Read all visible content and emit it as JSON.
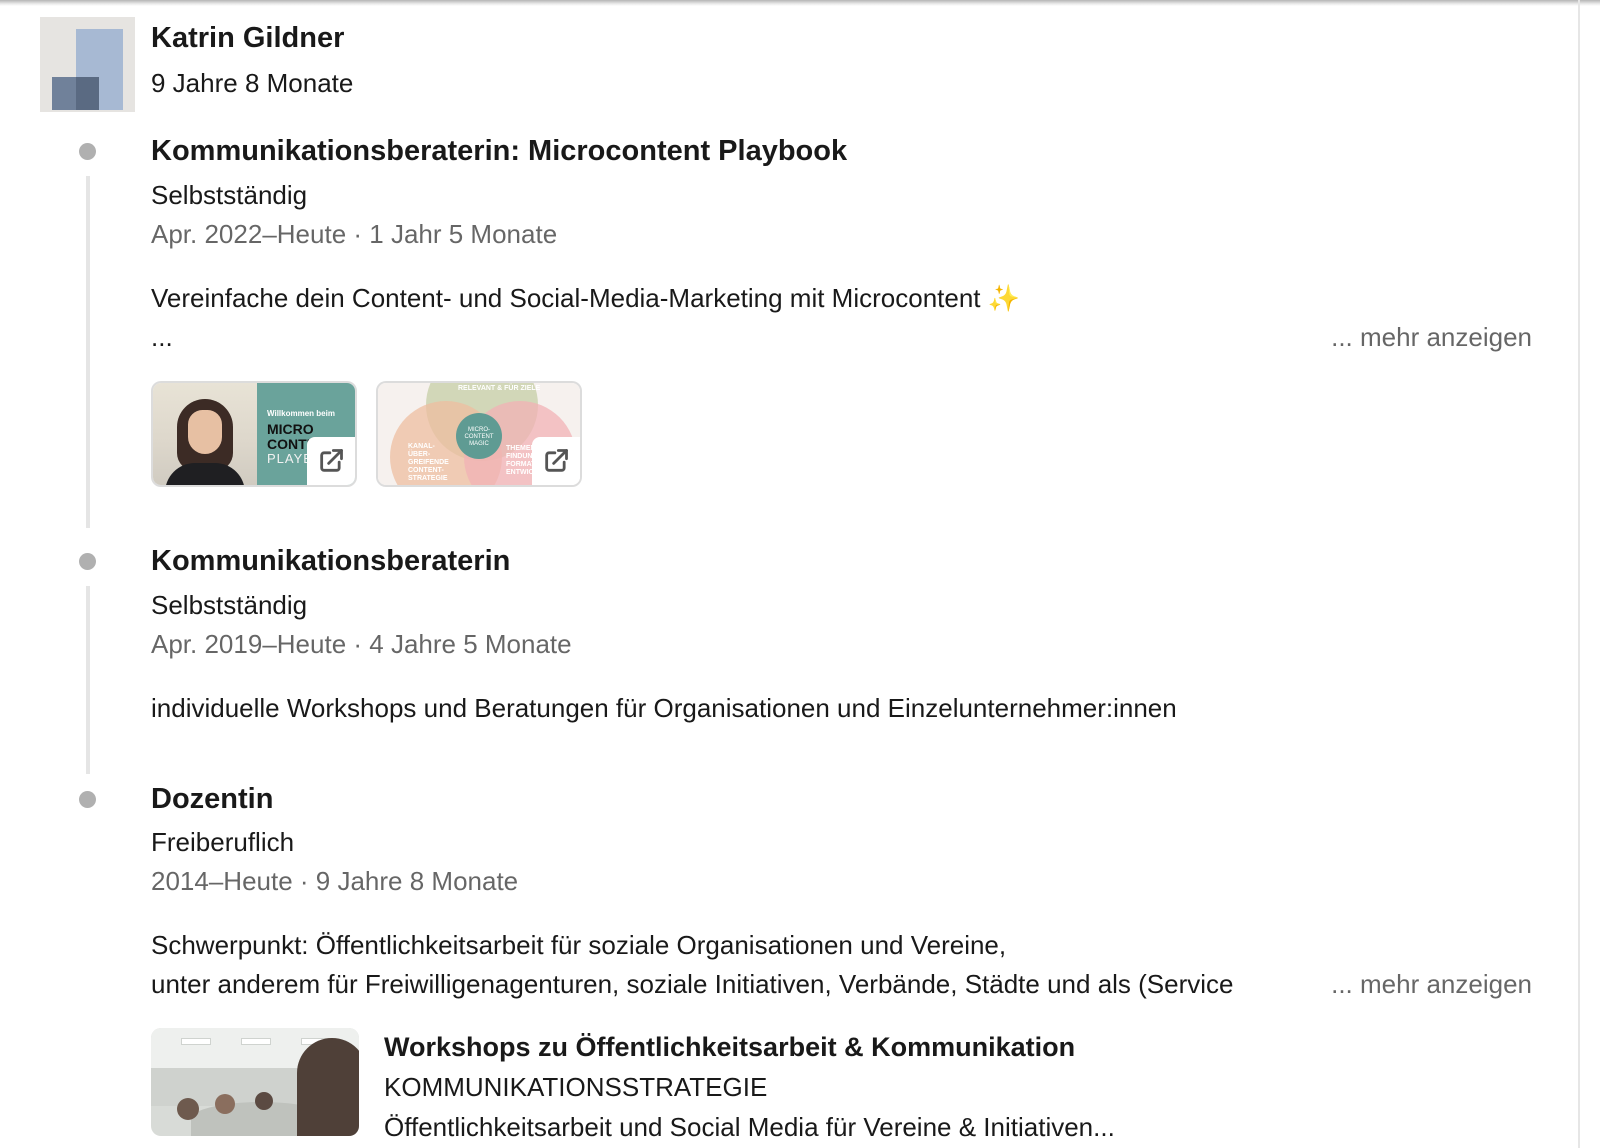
{
  "company": {
    "name": "Katrin Gildner",
    "duration": "9 Jahre 8 Monate"
  },
  "positions": [
    {
      "title": "Kommunikationsberaterin: Microcontent Playbook",
      "employment_type": "Selbstständig",
      "dates": "Apr. 2022–Heute · 1 Jahr 5 Monate",
      "description_line1": "Vereinfache dein Content- und Social-Media-Marketing mit Microcontent",
      "description_line2": "...",
      "more_label": "... mehr anzeigen",
      "media": [
        {
          "icon": "external-link-icon",
          "text_lines": [
            "Willkommen beim",
            "MICRO",
            "CONTENT",
            "PLAYB..."
          ]
        },
        {
          "icon": "external-link-icon",
          "text_lines": [
            "RELEVANT & FÜR ZIELE",
            "MICRO-CONTENT MAGIC",
            "KANAL-ÜBER-GREIFENDE CONTENT-STRATEGIE",
            "THEMEN-FINDUNG FORMAT-ENTWICK..."
          ]
        }
      ]
    },
    {
      "title": "Kommunikationsberaterin",
      "employment_type": "Selbstständig",
      "dates": "Apr. 2019–Heute · 4 Jahre 5 Monate",
      "description_line1": "individuelle Workshops und Beratungen für Organisationen und Einzelunternehmer:innen"
    },
    {
      "title": "Dozentin",
      "employment_type": "Freiberuflich",
      "dates": "2014–Heute · 9 Jahre 8 Monate",
      "description_line1": "Schwerpunkt: Öffentlichkeitsarbeit für soziale Organisationen und Vereine,",
      "description_line2": "unter anderem für Freiwilligenagenturen, soziale Initiativen, Verbände, Städte und als (Service",
      "more_label": "... mehr anzeigen",
      "featured": {
        "title": "Workshops zu Öffentlichkeitsarbeit & Kommunikation",
        "subtitle": "KOMMUNIKATIONSSTRATEGIE",
        "description": "Öffentlichkeitsarbeit und Social Media für Vereine & Initiativen..."
      }
    }
  ],
  "colors": {
    "timeline_dot": "#b0b0b0",
    "timeline_line": "#e5e5e5",
    "muted_text": "#666666",
    "sparkle": "#f3c93d"
  }
}
